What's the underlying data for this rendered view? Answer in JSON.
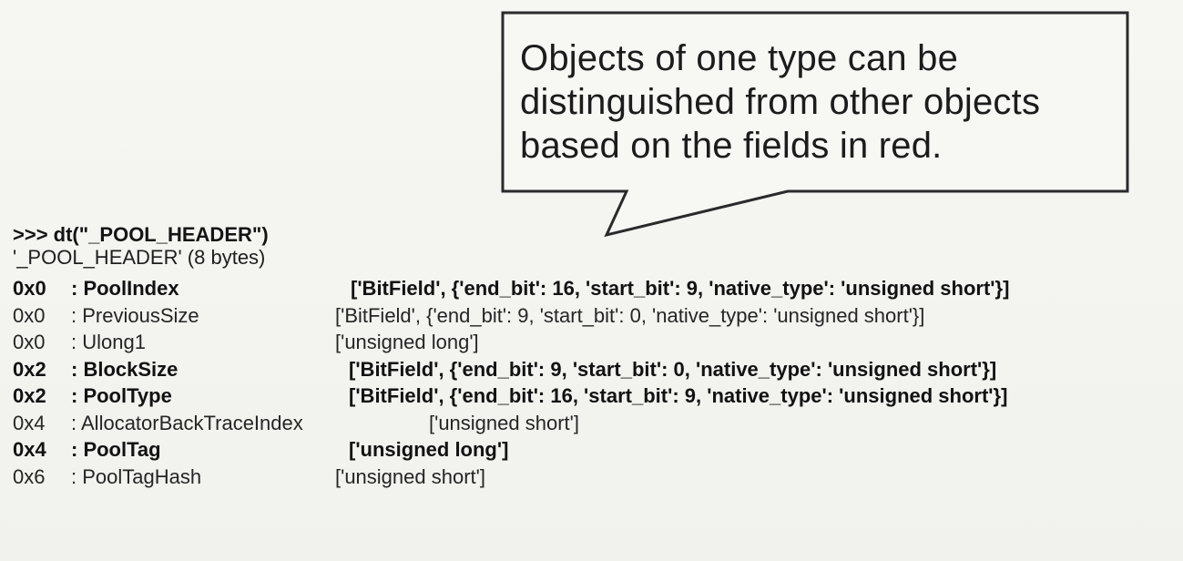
{
  "callout": {
    "lines": [
      "Objects of one type can be",
      "distinguished from other objects",
      "based on the fields in red."
    ]
  },
  "command": ">>> dt(\"_POOL_HEADER\")",
  "struct_header": "'_POOL_HEADER' (8 bytes)",
  "rows": [
    {
      "offset": "0x0",
      "field": ": PoolIndex",
      "type": "['BitField', {'end_bit': 16, 'start_bit': 9, 'native_type': 'unsigned short'}]",
      "emphasis": true
    },
    {
      "offset": "0x0",
      "field": ": PreviousSize",
      "type": "['BitField', {'end_bit': 9, 'start_bit': 0, 'native_type': 'unsigned short'}]",
      "emphasis": false
    },
    {
      "offset": "0x0",
      "field": ": Ulong1",
      "type": "['unsigned long']",
      "emphasis": false
    },
    {
      "offset": "0x2",
      "field": ": BlockSize",
      "type": "['BitField', {'end_bit': 9, 'start_bit': 0, 'native_type': 'unsigned short'}]",
      "emphasis": true
    },
    {
      "offset": "0x2",
      "field": ": PoolType",
      "type": "['BitField', {'end_bit': 16, 'start_bit': 9, 'native_type': 'unsigned short'}]",
      "emphasis": true
    },
    {
      "offset": "0x4",
      "field": ": AllocatorBackTraceIndex",
      "type": "['unsigned short']",
      "emphasis": false
    },
    {
      "offset": "0x4",
      "field": ": PoolTag",
      "type": "['unsigned long']",
      "emphasis": true
    },
    {
      "offset": "0x6",
      "field": ": PoolTagHash",
      "type": "['unsigned short']",
      "emphasis": false
    }
  ]
}
